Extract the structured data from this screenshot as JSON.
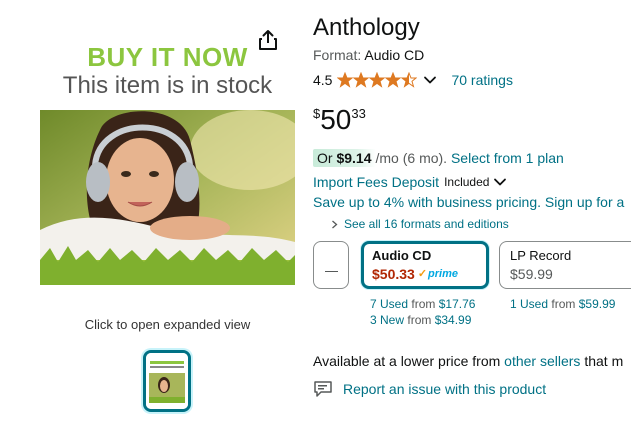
{
  "gallery": {
    "promo_line1": "BUY IT NOW",
    "promo_line2": "This item is in stock",
    "expand_caption": "Click to open expanded view",
    "share_icon": "share-icon"
  },
  "product": {
    "title": "Anthology",
    "format_label": "Format:",
    "format_value": "Audio CD",
    "rating_value": "4.5",
    "rating_stars": 4.5,
    "ratings_link": "70 ratings"
  },
  "price": {
    "symbol": "$",
    "whole": "50",
    "fraction": "33"
  },
  "installment": {
    "prefix": "Or",
    "amount": "$9.14",
    "term": "/mo (6 mo).",
    "link": "Select from 1 plan"
  },
  "fees": {
    "link": "Import Fees Deposit",
    "status": "Included"
  },
  "business": {
    "text": "Save up to 4% with business pricing. Sign up for a"
  },
  "formats": {
    "see_all": "See all 16 formats and editions",
    "options": [
      {
        "name": "Audio CD",
        "price": "$50.33",
        "badge": "prime",
        "used_count": "7 Used",
        "used_from": "from",
        "used_price": "$17.76",
        "new_count": "3 New",
        "new_from": "from",
        "new_price": "$34.99"
      },
      {
        "name": "LP Record",
        "price": "$59.99",
        "used_count": "1 Used",
        "used_from": "from",
        "used_price": "$59.99"
      }
    ]
  },
  "other_sellers": {
    "prefix": "Available at a lower price from",
    "link": "other sellers",
    "suffix": "that m"
  },
  "report": {
    "text": "Report an issue with this product"
  },
  "colors": {
    "link": "#007185",
    "price_red": "#b12704",
    "star": "#de7921",
    "promo_green": "#8cc63f",
    "selected_border": "#007185"
  }
}
